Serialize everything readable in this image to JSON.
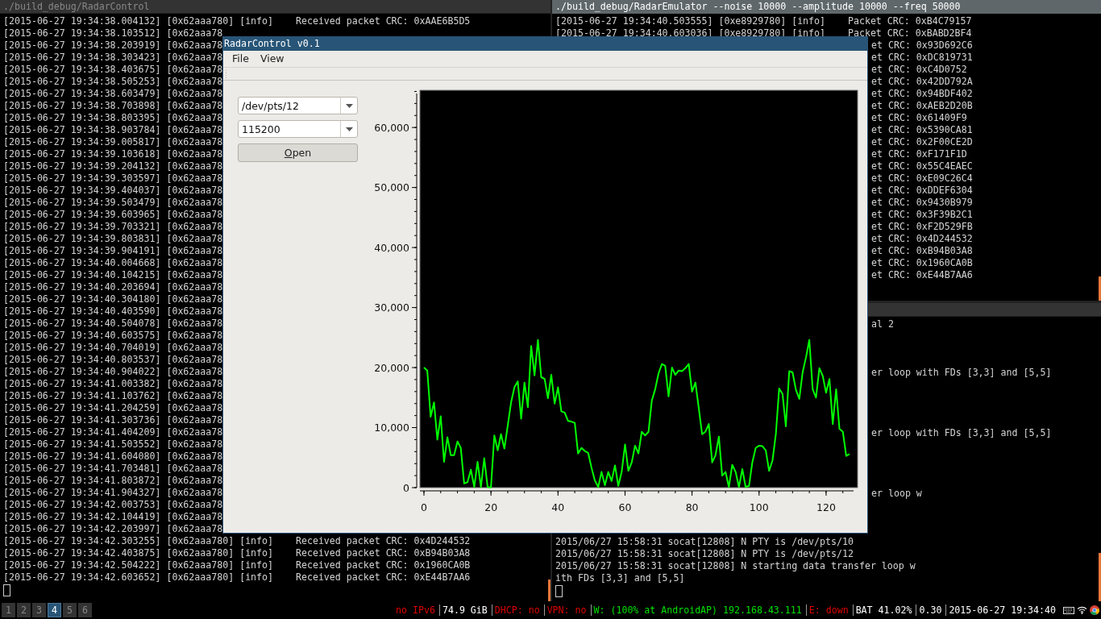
{
  "terminals": [
    {
      "title": "./build_debug/RadarControl",
      "focused": false,
      "cursor": true,
      "lines": [
        {
          "kind": "text",
          "text": "[2015-06-27 19:34:38.004132] [0x62aaa780] [info]    Received packet CRC: 0xAAE6B5D5"
        },
        {
          "kind": "text",
          "text": "[2015-06-27 19:34:38.103512] [0x62aaa78"
        },
        {
          "kind": "text",
          "text": "[2015-06-27 19:34:38.203919] [0x62aaa78"
        },
        {
          "kind": "text",
          "text": "[2015-06-27 19:34:38.303423] [0x62aaa78"
        },
        {
          "kind": "text",
          "text": "[2015-06-27 19:34:38.403675] [0x62aaa78"
        },
        {
          "kind": "text",
          "text": "[2015-06-27 19:34:38.505253] [0x62aaa78"
        },
        {
          "kind": "text",
          "text": "[2015-06-27 19:34:38.603479] [0x62aaa78"
        },
        {
          "kind": "text",
          "text": "[2015-06-27 19:34:38.703898] [0x62aaa78"
        },
        {
          "kind": "text",
          "text": "[2015-06-27 19:34:38.803395] [0x62aaa78"
        },
        {
          "kind": "text",
          "text": "[2015-06-27 19:34:38.903784] [0x62aaa78"
        },
        {
          "kind": "text",
          "text": "[2015-06-27 19:34:39.005817] [0x62aaa78"
        },
        {
          "kind": "text",
          "text": "[2015-06-27 19:34:39.103618] [0x62aaa78"
        },
        {
          "kind": "text",
          "text": "[2015-06-27 19:34:39.204132] [0x62aaa78"
        },
        {
          "kind": "text",
          "text": "[2015-06-27 19:34:39.303597] [0x62aaa78"
        },
        {
          "kind": "text",
          "text": "[2015-06-27 19:34:39.404037] [0x62aaa78"
        },
        {
          "kind": "text",
          "text": "[2015-06-27 19:34:39.503479] [0x62aaa78"
        },
        {
          "kind": "text",
          "text": "[2015-06-27 19:34:39.603965] [0x62aaa78"
        },
        {
          "kind": "text",
          "text": "[2015-06-27 19:34:39.703321] [0x62aaa78"
        },
        {
          "kind": "text",
          "text": "[2015-06-27 19:34:39.803831] [0x62aaa78"
        },
        {
          "kind": "text",
          "text": "[2015-06-27 19:34:39.904191] [0x62aaa78"
        },
        {
          "kind": "text",
          "text": "[2015-06-27 19:34:40.004668] [0x62aaa78"
        },
        {
          "kind": "text",
          "text": "[2015-06-27 19:34:40.104215] [0x62aaa78"
        },
        {
          "kind": "text",
          "text": "[2015-06-27 19:34:40.203694] [0x62aaa78"
        },
        {
          "kind": "text",
          "text": "[2015-06-27 19:34:40.304180] [0x62aaa78"
        },
        {
          "kind": "text",
          "text": "[2015-06-27 19:34:40.403590] [0x62aaa78"
        },
        {
          "kind": "text",
          "text": "[2015-06-27 19:34:40.504078] [0x62aaa78"
        },
        {
          "kind": "text",
          "text": "[2015-06-27 19:34:40.603575] [0x62aaa78"
        },
        {
          "kind": "text",
          "text": "[2015-06-27 19:34:40.704019] [0x62aaa78"
        },
        {
          "kind": "text",
          "text": "[2015-06-27 19:34:40.803537] [0x62aaa78"
        },
        {
          "kind": "text",
          "text": "[2015-06-27 19:34:40.904022] [0x62aaa78"
        },
        {
          "kind": "text",
          "text": "[2015-06-27 19:34:41.003382] [0x62aaa78"
        },
        {
          "kind": "text",
          "text": "[2015-06-27 19:34:41.103762] [0x62aaa78"
        },
        {
          "kind": "text",
          "text": "[2015-06-27 19:34:41.204259] [0x62aaa78"
        },
        {
          "kind": "text",
          "text": "[2015-06-27 19:34:41.303736] [0x62aaa78"
        },
        {
          "kind": "text",
          "text": "[2015-06-27 19:34:41.404209] [0x62aaa78"
        },
        {
          "kind": "text",
          "text": "[2015-06-27 19:34:41.503552] [0x62aaa78"
        },
        {
          "kind": "text",
          "text": "[2015-06-27 19:34:41.604080] [0x62aaa78"
        },
        {
          "kind": "text",
          "text": "[2015-06-27 19:34:41.703481] [0x62aaa78"
        },
        {
          "kind": "text",
          "text": "[2015-06-27 19:34:41.803872] [0x62aaa78"
        },
        {
          "kind": "text",
          "text": "[2015-06-27 19:34:41.904327] [0x62aaa78"
        },
        {
          "kind": "text",
          "text": "[2015-06-27 19:34:42.003753] [0x62aaa78"
        },
        {
          "kind": "text",
          "text": "[2015-06-27 19:34:42.104419] [0x62aaa78"
        },
        {
          "kind": "text",
          "text": "[2015-06-27 19:34:42.203997] [0x62aaa78"
        },
        {
          "kind": "text",
          "text": "[2015-06-27 19:34:42.303255] [0x62aaa780] [info]    Received packet CRC: 0x4D244532"
        },
        {
          "kind": "text",
          "text": "[2015-06-27 19:34:42.403875] [0x62aaa780] [info]    Received packet CRC: 0xB94B03A8"
        },
        {
          "kind": "text",
          "text": "[2015-06-27 19:34:42.504222] [0x62aaa780] [info]    Received packet CRC: 0x1960CA0B"
        },
        {
          "kind": "text",
          "text": "[2015-06-27 19:34:42.603652] [0x62aaa780] [info]    Received packet CRC: 0xE44B7AA6"
        }
      ]
    },
    {
      "title": "./build_debug/RadarEmulator --noise 10000 --amplitude 10000 --freq 50000",
      "focused": true,
      "cursor": false,
      "lines": [
        {
          "kind": "text",
          "text": "[2015-06-27 19:34:40.503555] [0xe8929780] [info]    Packet CRC: 0xB4C79157"
        },
        {
          "kind": "text",
          "text": "[2015-06-27 19:34:40.603036] [0xe8929780] [info]    Packet CRC: 0xBABD2BF4"
        },
        {
          "kind": "clipped",
          "text": "et CRC: 0x93D692C6"
        },
        {
          "kind": "clipped",
          "text": "et CRC: 0xDC819731"
        },
        {
          "kind": "clipped",
          "text": "et CRC: 0xC4D0752"
        },
        {
          "kind": "clipped",
          "text": "et CRC: 0x42DD792A"
        },
        {
          "kind": "clipped",
          "text": "et CRC: 0x94BDF402"
        },
        {
          "kind": "clipped",
          "text": "et CRC: 0xAEB2D20B"
        },
        {
          "kind": "clipped",
          "text": "et CRC: 0x61409F9"
        },
        {
          "kind": "clipped",
          "text": "et CRC: 0x5390CA81"
        },
        {
          "kind": "clipped",
          "text": "et CRC: 0x2F00CE2D"
        },
        {
          "kind": "clipped",
          "text": "et CRC: 0xF171F1D"
        },
        {
          "kind": "clipped",
          "text": "et CRC: 0x55C4EAEC"
        },
        {
          "kind": "clipped",
          "text": "et CRC: 0xE09C26C4"
        },
        {
          "kind": "clipped",
          "text": "et CRC: 0xDDEF6304"
        },
        {
          "kind": "clipped",
          "text": "et CRC: 0x9430B979"
        },
        {
          "kind": "clipped",
          "text": "et CRC: 0x3F39B2C1"
        },
        {
          "kind": "clipped",
          "text": "et CRC: 0xF2D529FB"
        },
        {
          "kind": "clipped",
          "text": "et CRC: 0x4D244532"
        },
        {
          "kind": "clipped",
          "text": "et CRC: 0xB94B03A8"
        },
        {
          "kind": "clipped",
          "text": "et CRC: 0x1960CA0B"
        },
        {
          "kind": "clipped",
          "text": "et CRC: 0xE44B7AA6"
        }
      ]
    },
    {
      "focused": false,
      "cursor": true,
      "lines": [
        {
          "kind": "clipped",
          "text": "al 2"
        },
        {
          "kind": "blank"
        },
        {
          "kind": "blank"
        },
        {
          "kind": "blank"
        },
        {
          "kind": "clipped",
          "text": "er loop with FDs [3,3] and [5,5]"
        },
        {
          "kind": "blank"
        },
        {
          "kind": "blank"
        },
        {
          "kind": "blank"
        },
        {
          "kind": "blank"
        },
        {
          "kind": "clipped",
          "text": "er loop with FDs [3,3] and [5,5]"
        },
        {
          "kind": "blank"
        },
        {
          "kind": "blank"
        },
        {
          "kind": "blank"
        },
        {
          "kind": "blank"
        },
        {
          "kind": "clipped",
          "text": "er loop w"
        },
        {
          "kind": "blank"
        },
        {
          "kind": "blank"
        },
        {
          "kind": "blank"
        },
        {
          "kind": "text",
          "text": "2015/06/27 15:58:31 socat[12808] N PTY is /dev/pts/10"
        },
        {
          "kind": "text",
          "text": "2015/06/27 15:58:31 socat[12808] N PTY is /dev/pts/12"
        },
        {
          "kind": "text",
          "text": "2015/06/27 15:58:31 socat[12808] N starting data transfer loop w"
        },
        {
          "kind": "text",
          "text": "ith FDs [3,3] and [5,5]"
        }
      ]
    }
  ],
  "window": {
    "title": "RadarControl v0.1",
    "menu": [
      "File",
      "View"
    ],
    "port": "/dev/pts/12",
    "baud": "115200",
    "button": {
      "label": "Open",
      "mnemonic": true
    },
    "chart_data": {
      "type": "line",
      "xlim": [
        -1.2,
        129.4
      ],
      "ylim": [
        0,
        66200
      ],
      "xticks": [
        0,
        20,
        40,
        60,
        80,
        100,
        120
      ],
      "yticks": [
        {
          "value": 0,
          "label": "0"
        },
        {
          "value": 10000,
          "label": "10,000"
        },
        {
          "value": 20000,
          "label": "20,000"
        },
        {
          "value": 30000,
          "label": "30,000"
        },
        {
          "value": 40000,
          "label": "40,000"
        },
        {
          "value": 50000,
          "label": "50,000"
        },
        {
          "value": 60000,
          "label": "60,000"
        }
      ],
      "x": [
        0,
        1,
        2,
        3,
        4,
        5,
        6,
        7,
        8,
        9,
        10,
        11,
        12,
        13,
        14,
        15,
        16,
        17,
        18,
        19,
        20,
        21,
        22,
        23,
        24,
        25,
        26,
        27,
        28,
        29,
        30,
        31,
        32,
        33,
        34,
        35,
        36,
        37,
        38,
        39,
        40,
        41,
        42,
        43,
        44,
        45,
        46,
        47,
        48,
        49,
        50,
        51,
        52,
        53,
        54,
        55,
        56,
        57,
        58,
        59,
        60,
        61,
        62,
        63,
        64,
        65,
        66,
        67,
        68,
        69,
        70,
        71,
        72,
        73,
        74,
        75,
        76,
        77,
        78,
        79,
        80,
        81,
        82,
        83,
        84,
        85,
        86,
        87,
        88,
        89,
        90,
        91,
        92,
        93,
        94,
        95,
        96,
        97,
        98,
        99,
        100,
        101,
        102,
        103,
        104,
        105,
        106,
        107,
        108,
        109,
        110,
        111,
        112,
        113,
        114,
        115,
        116,
        117,
        118,
        119,
        120,
        121,
        122,
        123,
        124,
        125,
        126,
        127
      ],
      "series": [
        {
          "color": "#00ff00",
          "values": [
            20000,
            19500,
            11800,
            14200,
            8000,
            11900,
            4300,
            8400,
            5400,
            5400,
            7700,
            6600,
            700,
            900,
            3000,
            100,
            4300,
            100,
            4900,
            100,
            0,
            8700,
            6200,
            8900,
            6500,
            10300,
            14200,
            16700,
            17700,
            11500,
            17500,
            13400,
            23600,
            18700,
            24600,
            18400,
            18100,
            14900,
            18800,
            14000,
            16700,
            12700,
            12500,
            11100,
            11000,
            10800,
            5700,
            6600,
            6100,
            5800,
            3300,
            1200,
            100,
            2600,
            400,
            2600,
            1100,
            3700,
            300,
            2600,
            7200,
            2800,
            4200,
            7000,
            5700,
            9300,
            8700,
            9300,
            14500,
            16400,
            19000,
            20600,
            20300,
            15200,
            20000,
            18800,
            19500,
            19400,
            19900,
            20600,
            16000,
            17500,
            13300,
            8900,
            9300,
            10600,
            4200,
            5400,
            8500,
            2000,
            2600,
            100,
            3800,
            2600,
            100,
            3100,
            100,
            300,
            4200,
            6600,
            7000,
            6900,
            6200,
            2800,
            4500,
            8900,
            16500,
            15600,
            10200,
            19400,
            19200,
            16300,
            14800,
            19200,
            21700,
            24600,
            16400,
            15000,
            19900,
            18600,
            15800,
            18100,
            10600,
            16400,
            9800,
            9300,
            5300,
            5600
          ]
        }
      ]
    }
  },
  "status_bar": {
    "workspaces": [
      {
        "label": "1",
        "selected": false
      },
      {
        "label": "2",
        "selected": false
      },
      {
        "label": "3",
        "selected": false
      },
      {
        "label": "4",
        "selected": true
      },
      {
        "label": "5",
        "selected": false
      },
      {
        "label": "6",
        "selected": false
      }
    ],
    "items": [
      {
        "text": "no IPv6",
        "color": "#e00000"
      },
      {
        "text": "74.9 GiB",
        "color": "#ffffff"
      },
      {
        "text": "DHCP: no",
        "color": "#e00000"
      },
      {
        "text": "VPN: no",
        "color": "#e00000"
      },
      {
        "text": "W: (100% at AndroidAP) 192.168.43.111",
        "color": "#00e000"
      },
      {
        "text": "E: down",
        "color": "#e00000"
      },
      {
        "text": "BAT 41.02%",
        "color": "#ffffff"
      },
      {
        "text": "0.30",
        "color": "#ffffff"
      },
      {
        "text": "2015-06-27 19:34:40",
        "color": "#ffffff"
      }
    ]
  }
}
